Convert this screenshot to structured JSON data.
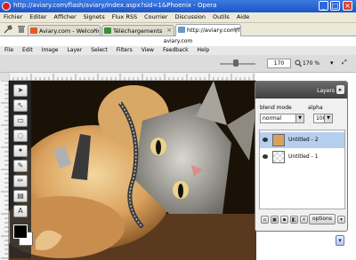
{
  "window": {
    "title": "http://aviary.com/flash/aviary/index.aspx?sid=1&Phoenix - Opera",
    "minimize": "_",
    "maximize": "□",
    "close": "×"
  },
  "browser_menu": [
    "Fichier",
    "Editer",
    "Afficher",
    "Signets",
    "Flux RSS",
    "Courrier",
    "Discussion",
    "Outils",
    "Aide"
  ],
  "tabs": [
    {
      "label": "Aviary.com - Welcome!"
    },
    {
      "label": "Téléchargements"
    },
    {
      "label": "http://aviary.com/fl..."
    }
  ],
  "address_text": "aviary.com",
  "app_menu": [
    "File",
    "Edit",
    "Image",
    "Layer",
    "Select",
    "Filters",
    "View",
    "Feedback",
    "Help"
  ],
  "zoom": {
    "value": "170",
    "percent": "170 %"
  },
  "toolbox": {
    "tools": [
      {
        "icon": "pointer-icon",
        "glyph": "➤"
      },
      {
        "icon": "arrow-select-icon",
        "glyph": "↖"
      },
      {
        "icon": "marquee-icon",
        "glyph": "▭"
      },
      {
        "icon": "lasso-icon",
        "glyph": "◌"
      },
      {
        "icon": "wand-icon",
        "glyph": "✦"
      },
      {
        "icon": "brush-icon",
        "glyph": "✎"
      },
      {
        "icon": "pencil-icon",
        "glyph": "✏"
      },
      {
        "icon": "gradient-icon",
        "glyph": "▤"
      },
      {
        "icon": "stamp-icon",
        "glyph": "⊞"
      },
      {
        "icon": "text-icon",
        "glyph": "A"
      },
      {
        "icon": "eraser-icon",
        "glyph": "▯"
      }
    ]
  },
  "layers_panel": {
    "title": "Layers",
    "blend_label": "blend mode",
    "alpha_label": "alpha",
    "blend_value": "normal",
    "alpha_value": "100",
    "layers": [
      {
        "name": "Untitled - 2",
        "selected": true
      },
      {
        "name": "Untitled - 1",
        "selected": false
      }
    ],
    "options_label": "options"
  },
  "colors": {
    "titlebar": "#1d55c8",
    "canvas_bg": "#1a1207",
    "selected_layer": "#b6cfee"
  }
}
